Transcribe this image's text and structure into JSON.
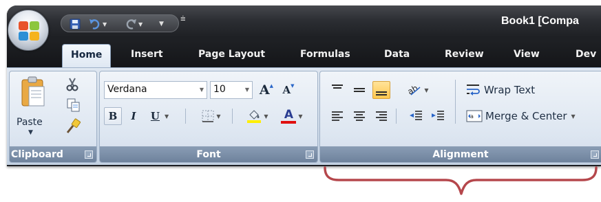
{
  "window": {
    "title": "Book1  [Compa"
  },
  "quick_access": {
    "icons": [
      "save-icon",
      "undo-icon",
      "redo-icon",
      "customize-toolbar-icon"
    ],
    "customize_glyph": "⩧"
  },
  "tabs": [
    {
      "label": "Home",
      "active": true
    },
    {
      "label": "Insert"
    },
    {
      "label": "Page Layout"
    },
    {
      "label": "Formulas"
    },
    {
      "label": "Data"
    },
    {
      "label": "Review"
    },
    {
      "label": "View"
    },
    {
      "label": "Dev"
    }
  ],
  "ribbon": {
    "clipboard": {
      "label": "Clipboard",
      "paste_label": "Paste",
      "icons": [
        "paste-icon",
        "cut-icon",
        "copy-icon",
        "format-painter-icon"
      ]
    },
    "font": {
      "label": "Font",
      "font_name": "Verdana",
      "font_size": "10",
      "grow_font": "A",
      "shrink_font": "A",
      "bold": "B",
      "italic": "I",
      "underline": "U",
      "font_color_letter": "A",
      "fill_color": "#ffef00",
      "font_color": "#e01010"
    },
    "alignment": {
      "label": "Alignment",
      "wrap_text": "Wrap Text",
      "merge_center": "Merge & Center",
      "selected": "bottom-align"
    }
  },
  "colors": {
    "titlebar": "#2c2e33",
    "ribbon": "#dfe7f1",
    "group_footer": "#7d90aa",
    "highlight": "#ffc84e",
    "annotation": "#b5474c"
  }
}
